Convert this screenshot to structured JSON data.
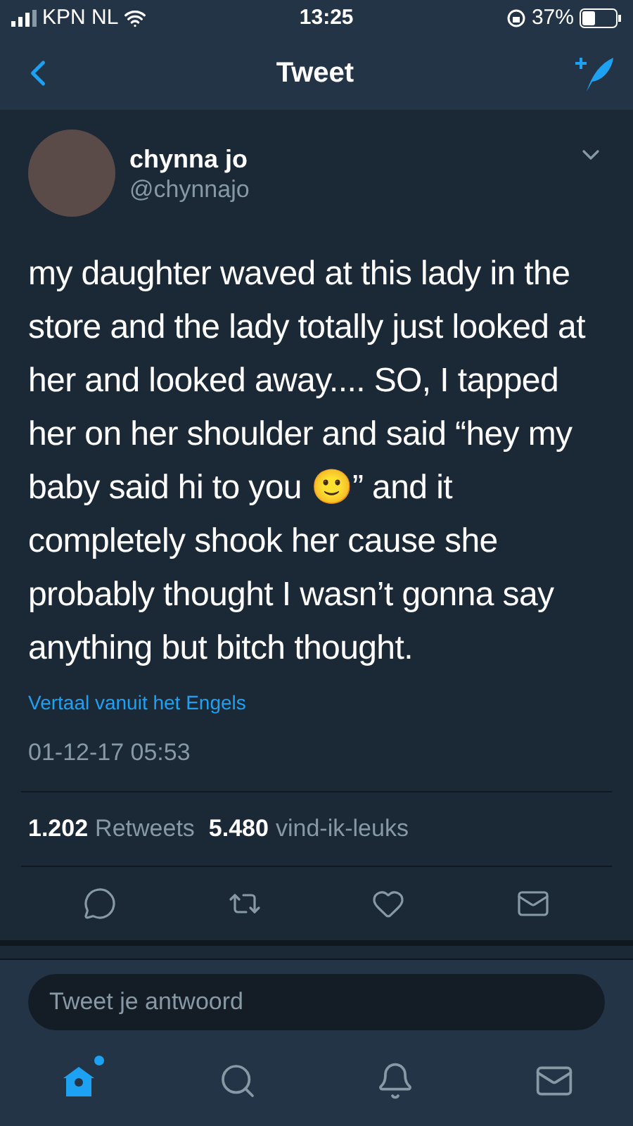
{
  "status_bar": {
    "carrier": "KPN NL",
    "time": "13:25",
    "battery": "37%"
  },
  "header": {
    "title": "Tweet"
  },
  "tweet": {
    "name": "chynna jo",
    "handle": "@chynnajo",
    "text": "my daughter waved at this lady in the store and the lady totally just looked at her and looked away.... SO, I tapped her on her shoulder and said “hey my baby said hi to you 🙂” and it completely shook her cause she probably thought I wasn’t gonna say anything but bitch thought.",
    "translate": "Vertaal vanuit het Engels",
    "date": "01-12-17 05:53"
  },
  "stats": [
    {
      "count": "1.202",
      "label": "Retweets"
    },
    {
      "count": "5.480",
      "label": "vind-ik-leuks"
    }
  ],
  "actions": [
    {
      "kind": "reply"
    },
    {
      "kind": "retweet"
    },
    {
      "kind": "like"
    },
    {
      "kind": "message"
    }
  ],
  "reply": {
    "placeholder": "Tweet je antwoord"
  },
  "tab_bar": [
    {
      "kind": "home",
      "selected": true,
      "new": true
    },
    {
      "kind": "search",
      "selected": false,
      "new": false
    },
    {
      "kind": "notifications",
      "selected": false,
      "new": false
    },
    {
      "kind": "messages",
      "selected": false,
      "new": false
    }
  ]
}
